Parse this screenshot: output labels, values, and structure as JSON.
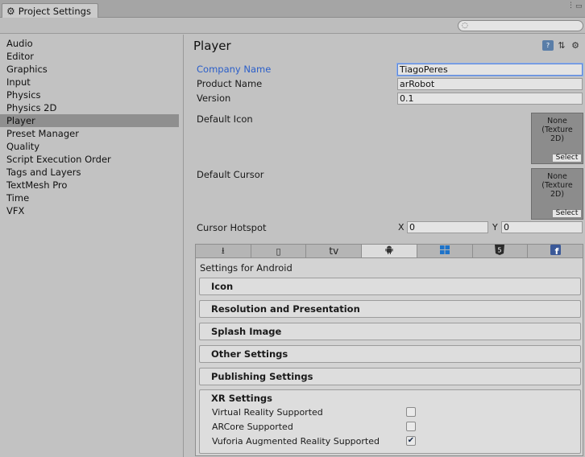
{
  "window": {
    "tab_title": "Project Settings",
    "menu_glyph": "⋮"
  },
  "search": {
    "placeholder": ""
  },
  "sidebar": {
    "items": [
      {
        "label": "Audio"
      },
      {
        "label": "Editor"
      },
      {
        "label": "Graphics"
      },
      {
        "label": "Input"
      },
      {
        "label": "Physics"
      },
      {
        "label": "Physics 2D"
      },
      {
        "label": "Player"
      },
      {
        "label": "Preset Manager"
      },
      {
        "label": "Quality"
      },
      {
        "label": "Script Execution Order"
      },
      {
        "label": "Tags and Layers"
      },
      {
        "label": "TextMesh Pro"
      },
      {
        "label": "Time"
      },
      {
        "label": "VFX"
      }
    ],
    "selected": "Player"
  },
  "player": {
    "title": "Player",
    "company_label": "Company Name",
    "company_value": "TiagoPeres",
    "product_label": "Product Name",
    "product_value": "arRobot",
    "version_label": "Version",
    "version_value": "0.1",
    "icon_label": "Default Icon",
    "cursor_label": "Default Cursor",
    "texture_none": "None\n(Texture\n2D)",
    "select_label": "Select",
    "hotspot_label": "Cursor Hotspot",
    "x_label": "X",
    "x_value": "0",
    "y_label": "Y",
    "y_value": "0"
  },
  "platforms": {
    "tabs": [
      {
        "name": "standalone",
        "glyph": "⭳"
      },
      {
        "name": "ios",
        "glyph": "▯"
      },
      {
        "name": "tvos",
        "glyph": "tv"
      },
      {
        "name": "android",
        "glyph": "🤖"
      },
      {
        "name": "windows",
        "glyph": "⊞"
      },
      {
        "name": "webgl",
        "glyph": "5"
      },
      {
        "name": "facebook",
        "glyph": "f"
      }
    ],
    "active": "android",
    "settings_for": "Settings for Android"
  },
  "sections": [
    {
      "label": "Icon"
    },
    {
      "label": "Resolution and Presentation"
    },
    {
      "label": "Splash Image"
    },
    {
      "label": "Other Settings"
    },
    {
      "label": "Publishing Settings"
    }
  ],
  "xr": {
    "title": "XR Settings",
    "rows": [
      {
        "label": "Virtual Reality Supported",
        "checked": false
      },
      {
        "label": "ARCore Supported",
        "checked": false
      },
      {
        "label": "Vuforia Augmented Reality Supported",
        "checked": true
      }
    ]
  },
  "colors": {
    "focus_label": "#2a5ec9",
    "selected_sidebar": "#8f8f8f",
    "panel_bg": "#c2c2c2"
  }
}
